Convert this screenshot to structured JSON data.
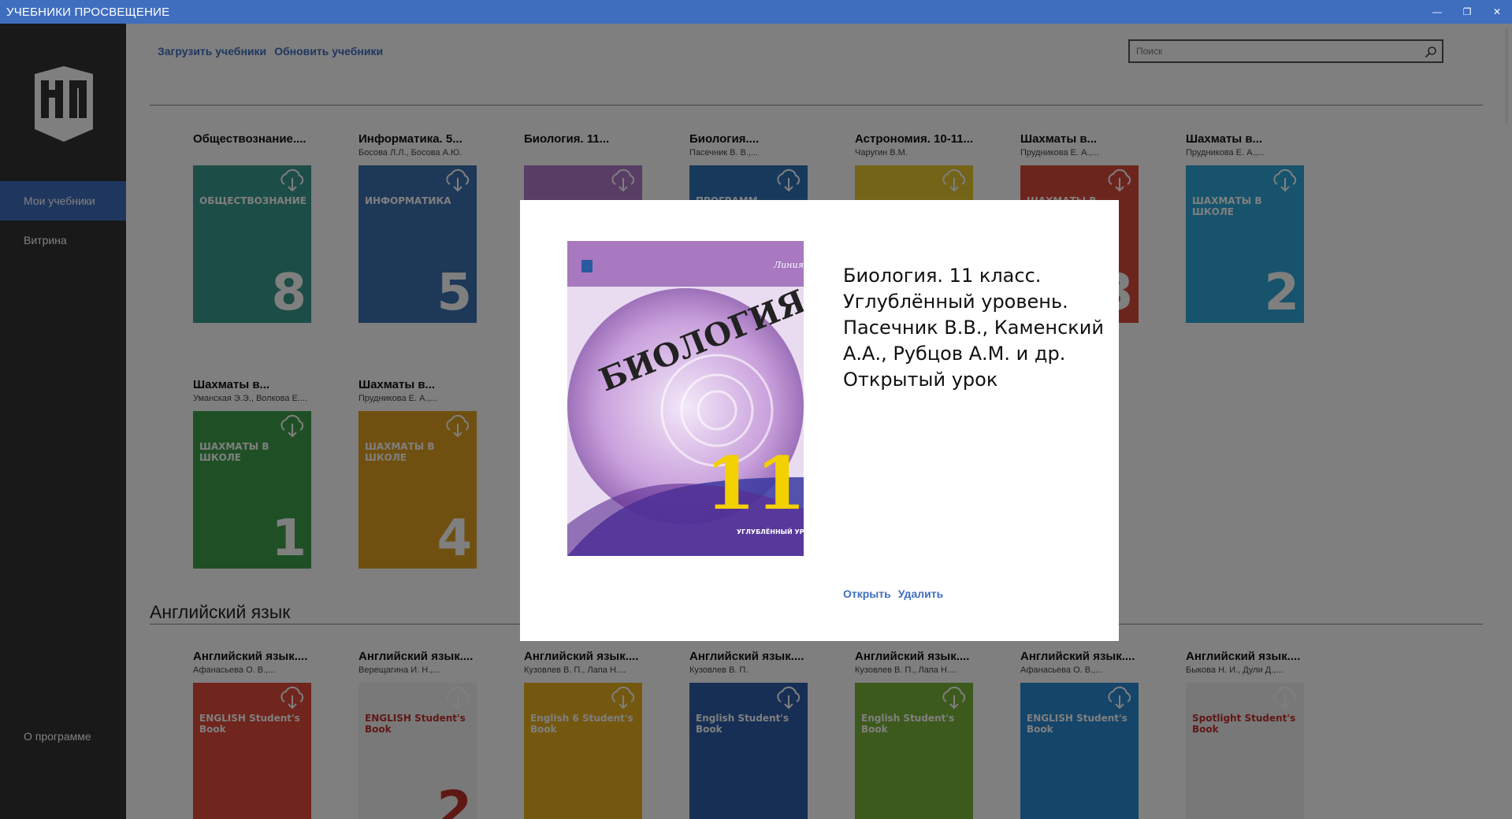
{
  "window": {
    "title": "УЧЕБНИКИ ПРОСВЕЩЕНИЕ",
    "minimize": "—",
    "restore": "❐",
    "close": "✕"
  },
  "sidebar": {
    "items": [
      {
        "label": "Мои учебники",
        "active": true
      },
      {
        "label": "Витрина",
        "active": false
      }
    ],
    "about": "О программе"
  },
  "toolbar": {
    "load_label": "Загрузить учебники",
    "refresh_label": "Обновить учебники",
    "search_placeholder": "Поиск"
  },
  "books_top": [
    {
      "title": "Обществознание....",
      "author": "",
      "cover_text": "ОБЩЕСТВОЗНАНИЕ",
      "cover_num": "8",
      "color": "#3a9a8e"
    },
    {
      "title": "Информатика. 5...",
      "author": "Босова Л.Л., Босова А.Ю.",
      "cover_text": "ИНФОРМАТИКА",
      "cover_num": "5",
      "color": "#3c70b0"
    },
    {
      "title": "Биология. 11...",
      "author": "",
      "cover_text": "",
      "cover_num": "",
      "color": "#b07ac8"
    },
    {
      "title": "Биология....",
      "author": "Пасечник В. В.,...",
      "cover_text": "ПРОГРАММ",
      "cover_num": "",
      "color": "#2e72b8"
    },
    {
      "title": "Астрономия. 10-11...",
      "author": "Чаругин В.М.",
      "cover_text": "",
      "cover_num": "",
      "color": "#e8c830"
    },
    {
      "title": "Шахматы в...",
      "author": "Прудникова Е. А.,...",
      "cover_text": "ШАХМАТЫ В ШКОЛЕ",
      "cover_num": "3",
      "color": "#d94a3a"
    },
    {
      "title": "Шахматы в...",
      "author": "Прудникова Е. А.,...",
      "cover_text": "ШАХМАТЫ В ШКОЛЕ",
      "cover_num": "2",
      "color": "#2ea6d8"
    },
    {
      "title": "Шахматы в...",
      "author": "Уманская Э.Э., Волкова Е....",
      "cover_text": "ШАХМАТЫ В ШКОЛЕ",
      "cover_num": "1",
      "color": "#3fa04a"
    },
    {
      "title": "Шахматы в...",
      "author": "Прудникова Е. А.,...",
      "cover_text": "ШАХМАТЫ В ШКОЛЕ",
      "cover_num": "4",
      "color": "#e0a020"
    }
  ],
  "section_english": "Английский язык",
  "books_english": [
    {
      "title": "Английский язык....",
      "author": "Афанасьева О. В.,...",
      "cover_text": "ENGLISH Student's Book",
      "cover_num": "",
      "color": "#e04a3a"
    },
    {
      "title": "Английский язык....",
      "author": "Верещагина И. Н.,...",
      "cover_text": "ENGLISH Student's Book",
      "cover_num": "2",
      "color": "#f2f2f2"
    },
    {
      "title": "Английский язык....",
      "author": "Кузовлев В. П., Лапа Н....",
      "cover_text": "English 6 Student's Book",
      "cover_num": "",
      "color": "#e8b020"
    },
    {
      "title": "Английский язык....",
      "author": "Кузовлев В. П.",
      "cover_text": "English Student's Book",
      "cover_num": "",
      "color": "#2f5fa8"
    },
    {
      "title": "Английский язык....",
      "author": "Кузовлев В. П., Лапа Н....",
      "cover_text": "English Student's Book",
      "cover_num": "",
      "color": "#7ab43a"
    },
    {
      "title": "Английский язык....",
      "author": "Афанасьева О. В.,...",
      "cover_text": "ENGLISH Student's Book",
      "cover_num": "",
      "color": "#2a8ad0"
    },
    {
      "title": "Английский язык....",
      "author": "Быкова Н. И., Дули Д.,...",
      "cover_text": "Spotlight Student's Book",
      "cover_num": "",
      "color": "#f0f0f0"
    }
  ],
  "modal": {
    "cover_series": "Линия жизни",
    "cover_title": "БИОЛОГИЯ",
    "cover_num": "11",
    "cover_level": "УГЛУБЛЁННЫЙ УРОВЕНЬ",
    "lines": [
      "Биология. 11 класс.",
      "Углублённый уровень.",
      "Пасечник В.В., Каменский",
      "А.А., Рубцов А.М. и др.",
      "Открытый урок"
    ],
    "open_label": "Открыть",
    "delete_label": "Удалить"
  }
}
